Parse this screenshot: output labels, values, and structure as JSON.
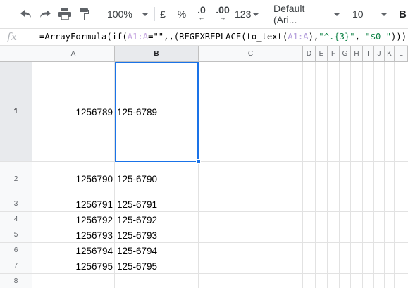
{
  "toolbar": {
    "zoom": "100%",
    "currency": "£",
    "percent": "%",
    "decrease_decimals": ".0",
    "increase_decimals": ".00",
    "more_formats": "123",
    "font_family": "Default (Ari...",
    "font_size": "10",
    "bold": "B"
  },
  "formula_bar": {
    "fx": "fx",
    "parts": {
      "p1": "=ArrayFormula(if(",
      "ref1": "A1:A",
      "p2": "=\"\",,(REGEXREPLACE(to_text(",
      "ref2": "A1:A",
      "p3": "),",
      "str1": "\"^.{3}\"",
      "p4": ", ",
      "str2": "\"$0-\"",
      "p5": "))))"
    }
  },
  "columns": [
    "A",
    "B",
    "C",
    "D",
    "E",
    "F",
    "G",
    "H",
    "I",
    "J",
    "K",
    "L"
  ],
  "rows": [
    {
      "num": "1",
      "a": "1256789",
      "b": "125-6789"
    },
    {
      "num": "2",
      "a": "1256790",
      "b": "125-6790"
    },
    {
      "num": "3",
      "a": "1256791",
      "b": "125-6791"
    },
    {
      "num": "4",
      "a": "1256792",
      "b": "125-6792"
    },
    {
      "num": "5",
      "a": "1256793",
      "b": "125-6793"
    },
    {
      "num": "6",
      "a": "1256794",
      "b": "125-6794"
    },
    {
      "num": "7",
      "a": "1256795",
      "b": "125-6795"
    },
    {
      "num": "8",
      "a": "",
      "b": ""
    }
  ],
  "selected_cell": "B1",
  "colors": {
    "selection": "#1a73e8",
    "header_bg": "#f8f9fa",
    "string": "#0b8043"
  }
}
